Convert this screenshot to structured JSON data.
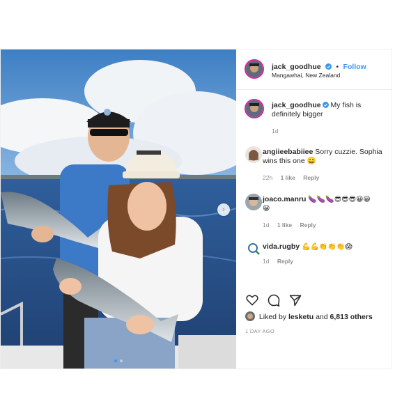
{
  "post": {
    "author": "jack_goodhue",
    "follow_label": "Follow",
    "bullet": "•",
    "location": "Mangawhai, New Zealand",
    "caption": "My fish is definitely bigger",
    "caption_time": "1d",
    "photo_dots": 2
  },
  "comments": [
    {
      "user": "angiieebabiiee",
      "text": "Sorry cuzzie. Sophia wins this one 😀",
      "time": "22h",
      "likes": "1 like",
      "reply": "Reply"
    },
    {
      "user": "joaco.manru",
      "text": "🍆🍆🍆😎😎😎😀😀😀",
      "time": "1d",
      "likes": "1 like",
      "reply": "Reply"
    },
    {
      "user": "vida.rugby",
      "text": "💪💪👏👏👏😱",
      "time": "1d",
      "likes": "",
      "reply": "Reply"
    }
  ],
  "likes": {
    "prefix": "Liked by",
    "user": "lesketu",
    "and": "and",
    "count": "6,813 others"
  },
  "time_ago": "1 DAY AGO",
  "icons": [
    "verified-badge-icon",
    "heart-icon",
    "comment-icon",
    "share-icon",
    "next-arrow-icon"
  ],
  "colors": {
    "accent": "#3897f0",
    "story_ring": "#d6249f",
    "muted": "#8e8e8e"
  }
}
